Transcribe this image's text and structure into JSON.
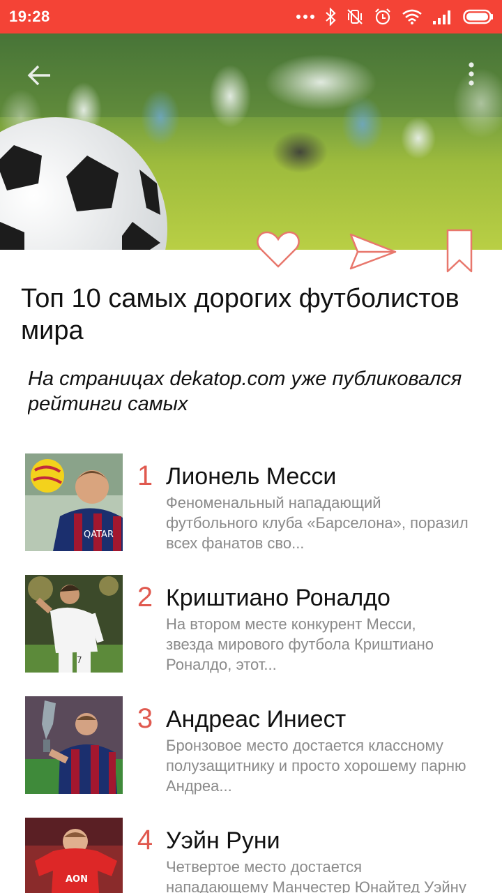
{
  "status_bar": {
    "time": "19:28",
    "background": "#f44336",
    "icons": [
      "more-dots-icon",
      "bluetooth-icon",
      "vibrate-off-icon",
      "alarm-icon",
      "wifi-icon",
      "signal-icon",
      "battery-icon"
    ]
  },
  "toolbar": {
    "back_icon": "arrow-back-icon",
    "menu_icon": "more-vert-icon"
  },
  "actions": {
    "like_icon": "heart-icon",
    "share_icon": "send-icon",
    "bookmark_icon": "bookmark-icon",
    "accent": "#e8776c"
  },
  "article": {
    "title": "Топ 10 самых дорогих футболистов мира",
    "lead": "На страницах dekatop.com уже публиковался рейтинги самых"
  },
  "list": {
    "accent": "#e0594f",
    "items": [
      {
        "rank": "1",
        "name": "Лионель Месси",
        "desc": "Феноменальный нападающий\nфутбольного клуба «Барселона», поразил\nвсех фанатов сво..."
      },
      {
        "rank": "2",
        "name": "Криштиано Роналдо",
        "desc": "На втором месте конкурент Месси,\nзвезда мирового футбола Криштиано\nРоналдо, этот..."
      },
      {
        "rank": "3",
        "name": "Андреас Иниест",
        "desc": "Бронзовое место достается классному\nполузащитнику и просто хорошему парню\nАндреа..."
      },
      {
        "rank": "4",
        "name": "Уэйн Руни",
        "desc": "Четвертое место достается\nнападающему Манчестер Юнайтед Уэйну"
      }
    ]
  }
}
